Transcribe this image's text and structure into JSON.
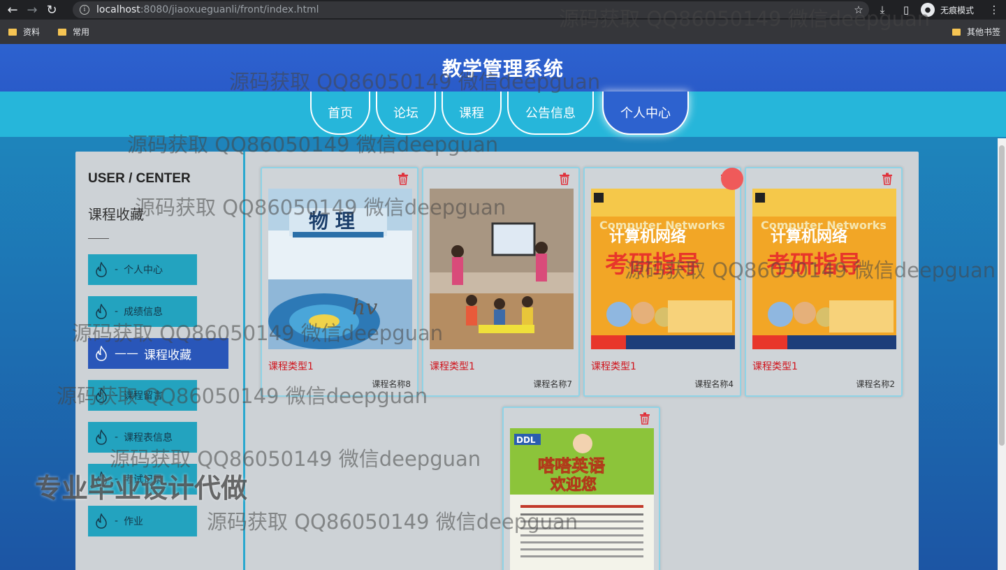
{
  "browser": {
    "url_host": "localhost",
    "url_path": ":8080/jiaoxueguanli/front/index.html",
    "incognito_label": "无痕模式",
    "bookmarks": [
      "资料",
      "常用"
    ],
    "other_bookmarks": "其他书签"
  },
  "site": {
    "title": "教学管理系统",
    "nav": [
      "首页",
      "论坛",
      "课程",
      "公告信息",
      "个人中心"
    ],
    "nav_active": "个人中心"
  },
  "sidebar": {
    "title": "USER / CENTER",
    "subtitle": "课程收藏",
    "items": [
      {
        "label": "个人中心",
        "active": false
      },
      {
        "label": "成绩信息",
        "active": false
      },
      {
        "label": "课程收藏",
        "active": true
      },
      {
        "label": "课程留言",
        "active": false
      },
      {
        "label": "课程表信息",
        "active": false
      },
      {
        "label": "考试记录",
        "active": false
      },
      {
        "label": "作业",
        "active": false
      }
    ]
  },
  "cards": [
    {
      "type": "课程类型1",
      "name": "课程名称8",
      "image": "physics-textbook"
    },
    {
      "type": "课程类型1",
      "name": "课程名称7",
      "image": "classroom-photo"
    },
    {
      "type": "课程类型1",
      "name": "课程名称4",
      "image": "computer-networks-book"
    },
    {
      "type": "课程类型1",
      "name": "课程名称2",
      "image": "computer-networks-book"
    },
    {
      "type": "",
      "name": "",
      "image": "english-poster"
    }
  ],
  "watermark": "源码获取 QQ86050149 微信deepguan",
  "banner": "专业毕业设计代做",
  "colors": {
    "header": "#2d62cf",
    "nav_strip": "#26b6da",
    "sidebar_item": "#23a3bf",
    "sidebar_active": "#2956b9",
    "course_type": "#d0141c"
  }
}
